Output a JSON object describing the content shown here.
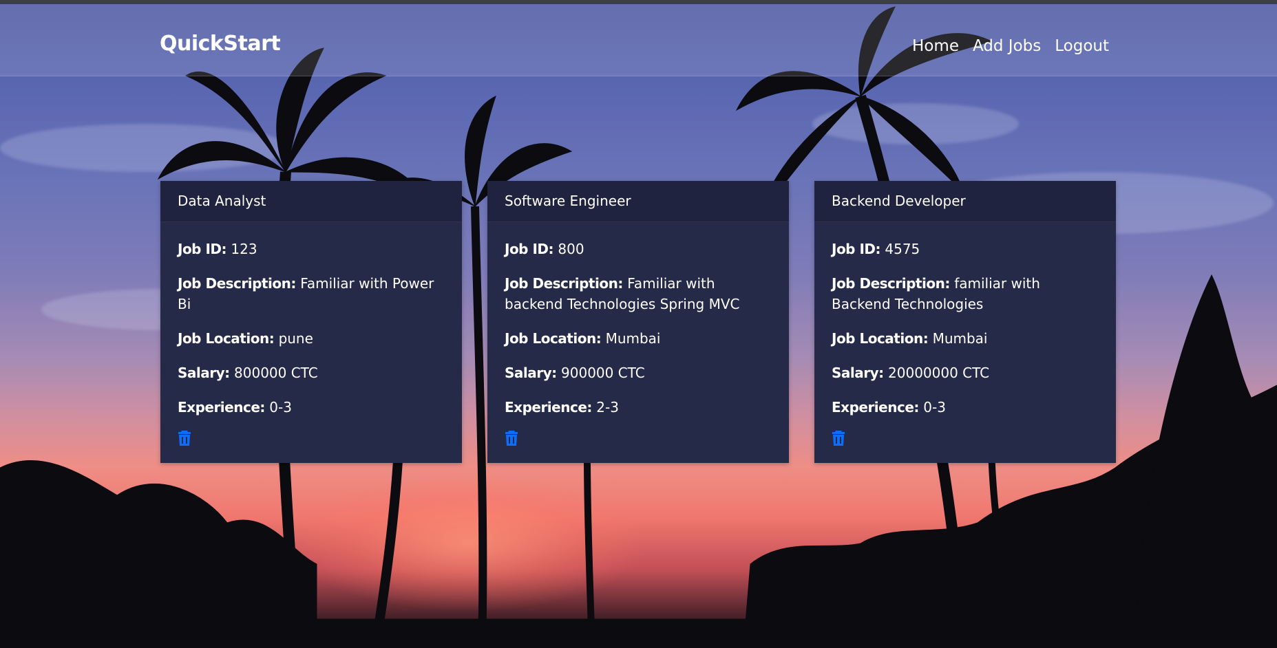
{
  "navbar": {
    "brand": "QuickStart",
    "links": [
      "Home",
      "Add Jobs",
      "Logout"
    ]
  },
  "labels": {
    "job_id": "Job ID:",
    "job_description": "Job Description:",
    "job_location": "Job Location:",
    "salary": "Salary:",
    "experience": "Experience:"
  },
  "jobs": [
    {
      "title": "Data Analyst",
      "job_id": "123",
      "description": "Familiar with Power Bi",
      "location": "pune",
      "salary": "800000 CTC",
      "experience": "0-3"
    },
    {
      "title": "Software Engineer",
      "job_id": "800",
      "description": "Familiar with backend Technologies Spring MVC",
      "location": "Mumbai",
      "salary": "900000 CTC",
      "experience": "2-3"
    },
    {
      "title": "Backend Developer",
      "job_id": "4575",
      "description": "familiar with Backend Technologies",
      "location": "Mumbai",
      "salary": "20000000 CTC",
      "experience": "0-3"
    }
  ],
  "icons": {
    "delete": "trash-icon"
  },
  "colors": {
    "card_bg": "#252a49",
    "card_header_bg": "#1f2340",
    "trash_icon": "#0d6efd"
  }
}
